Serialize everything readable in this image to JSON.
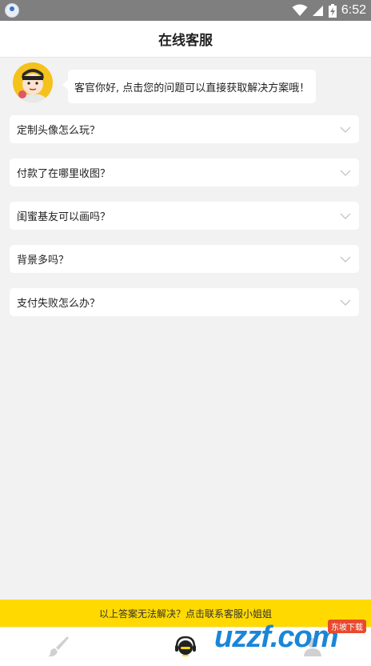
{
  "status_bar": {
    "time": "6:52"
  },
  "header": {
    "title": "在线客服"
  },
  "greeting": {
    "text": "客官你好, 点击您的问题可以直接获取解决方案哦！"
  },
  "faq": [
    {
      "question": "定制头像怎么玩？"
    },
    {
      "question": "付款了在哪里收图？"
    },
    {
      "question": "闺蜜基友可以画吗？"
    },
    {
      "question": "背景多吗？"
    },
    {
      "question": "支付失败怎么办？"
    }
  ],
  "contact_bar": {
    "text": "以上答案无法解决？点击联系客服小姐姐"
  },
  "watermark": {
    "text": "uzzf.com",
    "badge": "东坡下载"
  },
  "colors": {
    "accent": "#ffd900",
    "status_bar": "#7f7f7f",
    "background": "#f2f2f2"
  }
}
